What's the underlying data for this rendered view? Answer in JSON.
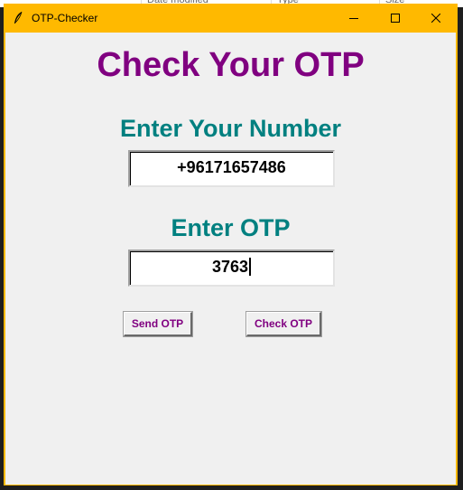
{
  "background_window": {
    "columns": [
      "Date modified",
      "Type",
      "Size"
    ]
  },
  "window": {
    "title": "OTP-Checker",
    "title_icon": "feather-icon",
    "controls": {
      "minimize_icon": "minimize-icon",
      "maximize_icon": "maximize-icon",
      "close_icon": "close-icon"
    },
    "titlebar_color": "#ffb900"
  },
  "form": {
    "title": "Check Your OTP",
    "number_label": "Enter Your Number",
    "number_value": "+96171657486",
    "otp_label": "Enter OTP",
    "otp_value": "3763",
    "send_button": "Send OTP",
    "check_button": "Check OTP"
  },
  "colors": {
    "title": "#800080",
    "labels": "#008080",
    "buttons_text": "#800080",
    "content_bg": "#f0f0f0"
  }
}
